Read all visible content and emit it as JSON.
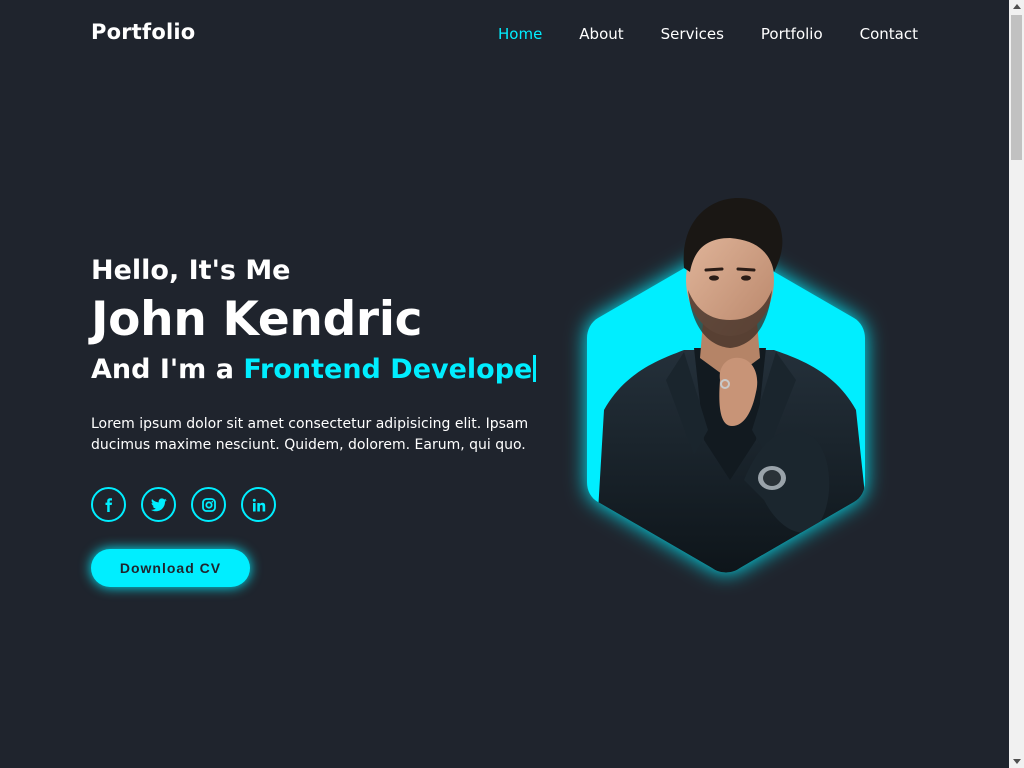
{
  "header": {
    "logo": "Portfolio",
    "nav": [
      {
        "label": "Home",
        "active": true
      },
      {
        "label": "About",
        "active": false
      },
      {
        "label": "Services",
        "active": false
      },
      {
        "label": "Portfolio",
        "active": false
      },
      {
        "label": "Contact",
        "active": false
      }
    ]
  },
  "hero": {
    "greeting": "Hello, It's Me",
    "name": "John Kendric",
    "role_prefix": "And I'm a ",
    "role_typed": "Frontend Develope",
    "description": "Lorem ipsum dolor sit amet consectetur adipisicing elit. Ipsam ducimus maxime nesciunt. Quidem, dolorem. Earum, qui quo.",
    "socials": [
      {
        "icon": "facebook-icon"
      },
      {
        "icon": "twitter-icon"
      },
      {
        "icon": "instagram-icon"
      },
      {
        "icon": "linkedin-icon"
      }
    ],
    "cta_label": "Download CV",
    "image_icon": "portrait-photo"
  },
  "colors": {
    "background": "#1f242d",
    "accent": "#00eeff",
    "text": "#ffffff"
  }
}
